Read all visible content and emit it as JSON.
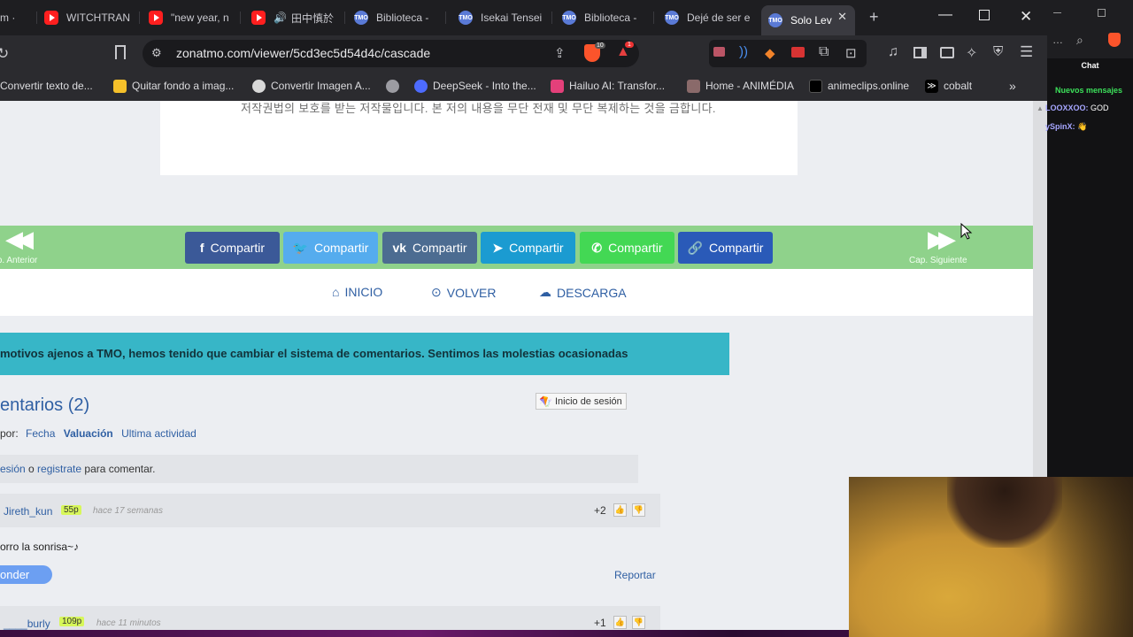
{
  "browser": {
    "tabs": [
      {
        "title": "m ·",
        "icon": "tmo-icon"
      },
      {
        "title": "WITCHTRAN",
        "icon": "youtube-icon"
      },
      {
        "title": "\"new year, n",
        "icon": "youtube-icon"
      },
      {
        "title": "田中慎於",
        "icon": "youtube-icon"
      },
      {
        "title": "Biblioteca - ",
        "icon": "tmo-icon"
      },
      {
        "title": "Isekai Tensei",
        "icon": "tmo-icon"
      },
      {
        "title": "Biblioteca - ",
        "icon": "tmo-icon"
      },
      {
        "title": "Dejé de ser e",
        "icon": "tmo-icon"
      },
      {
        "title": "Solo Lev",
        "icon": "tmo-icon"
      }
    ],
    "url": "zonatmo.com/viewer/5cd3ec5d54d4c/cascade",
    "brave_badge": "10",
    "alert_badge": "1",
    "bookmarks": [
      "Convertir texto de...",
      "Quitar fondo a imag...",
      "Convertir Imagen A...",
      "",
      "DeepSeek - Into the...",
      "Hailuo AI: Transfor...",
      "Home - ANIMÉDIA",
      "animeclips.online",
      "cobalt"
    ]
  },
  "page": {
    "korean_notice": "저작권법의 보호를 받는 저작물입니다. 본 저의 내용을 무단 전재 및 무단 복제하는 것을 금합니다.",
    "share_buttons": [
      {
        "label": "Compartir",
        "network": "facebook",
        "color": "#3b5998",
        "glyph": "f"
      },
      {
        "label": "Compartir",
        "network": "twitter",
        "color": "#55acee",
        "glyph": "🐦"
      },
      {
        "label": "Compartir",
        "network": "vk",
        "color": "#4c6c91",
        "glyph": "vk"
      },
      {
        "label": "Compartir",
        "network": "telegram",
        "color": "#1b9bd1",
        "glyph": "➤"
      },
      {
        "label": "Compartir",
        "network": "whatsapp",
        "color": "#43d854",
        "glyph": "✆"
      },
      {
        "label": "Compartir",
        "network": "link",
        "color": "#2a5ab8",
        "glyph": "🔗"
      }
    ],
    "prev_chapter": "Cap. Anterior",
    "next_chapter": "Cap. Siguiente",
    "nav_links": [
      {
        "label": "INICIO",
        "icon": "home-icon"
      },
      {
        "label": "VOLVER",
        "icon": "back-icon"
      },
      {
        "label": "DESCARGA",
        "icon": "download-icon"
      }
    ],
    "notice": "motivos ajenos a TMO, hemos tenido que cambiar el sistema de comentarios. Sentimos las molestias ocasionadas",
    "comments_title": "entarios (2)",
    "login_button": "Inicio de sesión",
    "sort": {
      "prefix": "por:",
      "options": [
        "Fecha",
        "Valuación",
        "Ultima actividad"
      ]
    },
    "login_prompt": {
      "login": "esión",
      "or": " o ",
      "register": "registrate",
      "suffix": " para comentar."
    },
    "comments": [
      {
        "user": "Jireth_kun",
        "points": "55p",
        "time": "hace 17 semanas",
        "score": "+2",
        "body": "orro la sonrisa~♪",
        "reply": "onder",
        "report": "Reportar"
      },
      {
        "user": "____burly",
        "points": "109p",
        "time": "hace 11 minutos",
        "score": "+1"
      }
    ]
  },
  "chat": {
    "title": "Chat",
    "new_messages": "Nuevos mensajes",
    "messages": [
      {
        "user": "LOOXXOO:",
        "text": "GOD"
      },
      {
        "user": "ySpinX:",
        "text": "👋"
      }
    ]
  }
}
